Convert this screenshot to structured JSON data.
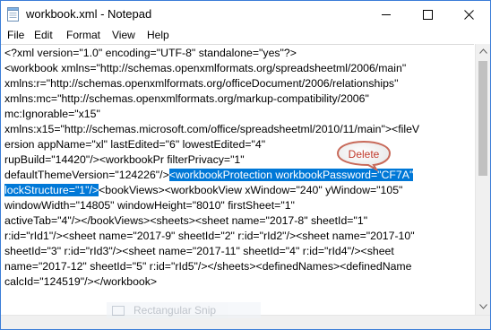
{
  "window": {
    "title": "workbook.xml - Notepad",
    "icon": "notepad-icon",
    "buttons": [
      "minimize-icon",
      "maximize-icon",
      "close-icon"
    ]
  },
  "menu": {
    "file": "File",
    "edit": "Edit",
    "format": "Format",
    "view": "View",
    "help": "Help"
  },
  "editor": {
    "line1": "<?xml version=\"1.0\" encoding=\"UTF-8\" standalone=\"yes\"?>",
    "line2": "<workbook xmlns=\"http://schemas.openxmlformats.org/spreadsheetml/2006/main\"",
    "line3": "xmlns:r=\"http://schemas.openxmlformats.org/officeDocument/2006/relationships\"",
    "line4": "xmlns:mc=\"http://schemas.openxmlformats.org/markup-compatibility/2006\"",
    "line5": "mc:Ignorable=\"x15\"",
    "line6": "xmlns:x15=\"http://schemas.microsoft.com/office/spreadsheetml/2010/11/main\"><fileV",
    "line7": "ersion appName=\"xl\" lastEdited=\"6\" lowestEdited=\"4\"",
    "line8": "rupBuild=\"14420\"/><workbookPr filterPrivacy=\"1\"",
    "line9_pre": "defaultThemeVersion=\"124226\"/>",
    "line9_sel": "<workbookProtection workbookPassword=\"CF7A\"",
    "line10_sel": "lockStructure=\"1\"/>",
    "line10_post": "<bookViews><workbookView xWindow=\"240\" yWindow=\"105\"",
    "line11": "windowWidth=\"14805\" windowHeight=\"8010\" firstSheet=\"1\"",
    "line12": "activeTab=\"4\"/></bookViews><sheets><sheet name=\"2017-8\" sheetId=\"1\"",
    "line13": "r:id=\"rId1\"/><sheet name=\"2017-9\" sheetId=\"2\" r:id=\"rId2\"/><sheet name=\"2017-10\"",
    "line14": "sheetId=\"3\" r:id=\"rId3\"/><sheet name=\"2017-11\" sheetId=\"4\" r:id=\"rId4\"/><sheet",
    "line15": "name=\"2017-12\" sheetId=\"5\" r:id=\"rId5\"/></sheets><definedNames><definedName",
    "line16": "calcId=\"124519\"/></workbook>",
    "selection_color": "#0078d7"
  },
  "callout": {
    "label": "Delete",
    "color": "#c0392b"
  },
  "watermark": {
    "label": "Rectangular Snip"
  },
  "colors": {
    "window_border": "#3b7dd8",
    "selection": "#0078d7"
  }
}
